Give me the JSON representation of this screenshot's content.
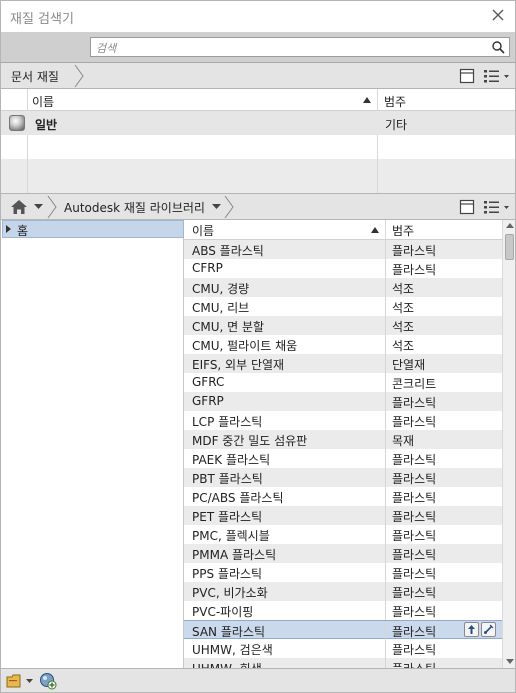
{
  "window": {
    "title": "재질 검색기"
  },
  "search": {
    "placeholder": "검색"
  },
  "document_panel": {
    "breadcrumb": "문서 재질",
    "columns": {
      "name": "이름",
      "category": "범주"
    },
    "rows": [
      {
        "name": "일반",
        "category": "기타"
      }
    ]
  },
  "library_panel": {
    "breadcrumb": "Autodesk 재질 라이브러리",
    "tree": [
      {
        "label": "홈",
        "selected": true
      }
    ],
    "columns": {
      "name": "이름",
      "category": "범주"
    },
    "rows": [
      {
        "name": "ABS 플라스틱",
        "category": "플라스틱"
      },
      {
        "name": "CFRP",
        "category": "플라스틱"
      },
      {
        "name": "CMU, 경량",
        "category": "석조"
      },
      {
        "name": "CMU, 리브",
        "category": "석조"
      },
      {
        "name": "CMU, 면 분할",
        "category": "석조"
      },
      {
        "name": "CMU, 펄라이트 채움",
        "category": "석조"
      },
      {
        "name": "EIFS, 외부 단열재",
        "category": "단열재"
      },
      {
        "name": "GFRC",
        "category": "콘크리트"
      },
      {
        "name": "GFRP",
        "category": "플라스틱"
      },
      {
        "name": "LCP 플라스틱",
        "category": "플라스틱"
      },
      {
        "name": "MDF 중간 밀도 섬유판",
        "category": "목재"
      },
      {
        "name": "PAEK 플라스틱",
        "category": "플라스틱"
      },
      {
        "name": "PBT 플라스틱",
        "category": "플라스틱"
      },
      {
        "name": "PC/ABS 플라스틱",
        "category": "플라스틱"
      },
      {
        "name": "PET 플라스틱",
        "category": "플라스틱"
      },
      {
        "name": "PMC, 플렉시블",
        "category": "플라스틱"
      },
      {
        "name": "PMMA 플라스틱",
        "category": "플라스틱"
      },
      {
        "name": "PPS 플라스틱",
        "category": "플라스틱"
      },
      {
        "name": "PVC, 비가소화",
        "category": "플라스틱"
      },
      {
        "name": "PVC-파이핑",
        "category": "플라스틱"
      },
      {
        "name": "SAN 플라스틱",
        "category": "플라스틱",
        "selected": true
      },
      {
        "name": "UHMW, 검은색",
        "category": "플라스틱"
      },
      {
        "name": "UHMW, 회색",
        "category": "플라스틱"
      }
    ]
  },
  "colors": {
    "selection": "#cbd9ec",
    "toolbar": "#e4e4e4",
    "search_bg": "#cfcfcf"
  }
}
